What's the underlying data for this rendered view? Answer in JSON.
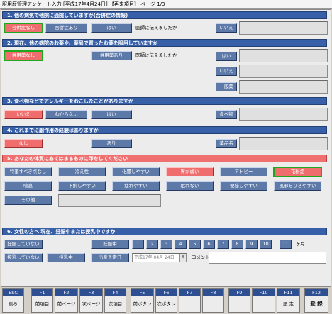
{
  "window_title": "服用歴管理アンケート入力 [平成17年4月24日] 【再来項目】 ページ 1/3",
  "section1": {
    "title": "1. 他の病気で他院に通院していますか(合併症の情報)",
    "buttons": [
      "合併症なし",
      "合併症あり",
      "はい"
    ],
    "told_doctor": "医師に伝えましたか",
    "no": "いいえ"
  },
  "section2": {
    "title": "2. 現在、他の病院のお薬や、薬局で買ったお薬を服用していますか",
    "buttons": [
      "併用薬なし",
      "併用薬あり"
    ],
    "told_doctor": "医師に伝えましたか",
    "yes": "はい",
    "no": "いいえ",
    "generic": "一般薬"
  },
  "section3": {
    "title": "3. 食べ物などでアレルギーをおこしたことがありますか",
    "buttons": [
      "いいえ",
      "わからない",
      "はい"
    ],
    "food": "食べ物"
  },
  "section4": {
    "title": "4. これまでに副作用の経験はありますか",
    "buttons": [
      "なし",
      "あり"
    ],
    "drug_name": "薬品名"
  },
  "section5": {
    "title": "5. あなたの体質にあてはまるものに印をしてください",
    "row1": [
      "特筆すべき点なし",
      "冷え性",
      "化膿しやすい",
      "胃が弱い",
      "アトピー",
      "花粉症"
    ],
    "row2": [
      "喘息",
      "下痢しやすい",
      "疲れやすい",
      "眠れない",
      "便秘しやすい",
      "風邪をひきやすい"
    ],
    "other": "その他"
  },
  "section6": {
    "title": "6. 女性の方へ 現在、妊娠中または授乳中ですか",
    "not_pregnant": "妊娠していない",
    "pregnant": "妊娠中",
    "months": [
      "1",
      "2",
      "3",
      "4",
      "5",
      "6",
      "7",
      "8",
      "9",
      "10",
      "11"
    ],
    "month_unit": "ヶ月",
    "not_nursing": "授乳していない",
    "nursing": "授乳中",
    "due_date": "出産予定日",
    "date_value": "平成17年 04月 24日",
    "comment": "コメント"
  },
  "fkeys": [
    {
      "key": "ESC",
      "label": "戻る"
    },
    {
      "key": "F1",
      "label": "前項目"
    },
    {
      "key": "F2",
      "label": "前ページ"
    },
    {
      "key": "F3",
      "label": "次ページ"
    },
    {
      "key": "F4",
      "label": "次項目"
    },
    {
      "key": "F5",
      "label": "前ボタン"
    },
    {
      "key": "F6",
      "label": "次ボタン"
    },
    {
      "key": "F7",
      "label": ""
    },
    {
      "key": "F8",
      "label": ""
    },
    {
      "key": "F9",
      "label": ""
    },
    {
      "key": "F10",
      "label": ""
    },
    {
      "key": "F11",
      "label": "設 定"
    },
    {
      "key": "F12",
      "label": "登 録"
    }
  ],
  "colors": {
    "section_blue": "#3860a8",
    "section_red": "#f07070",
    "button_blue": "#5d79a8",
    "button_red": "#ef6d6d",
    "selected_outline": "#1ea81e"
  }
}
